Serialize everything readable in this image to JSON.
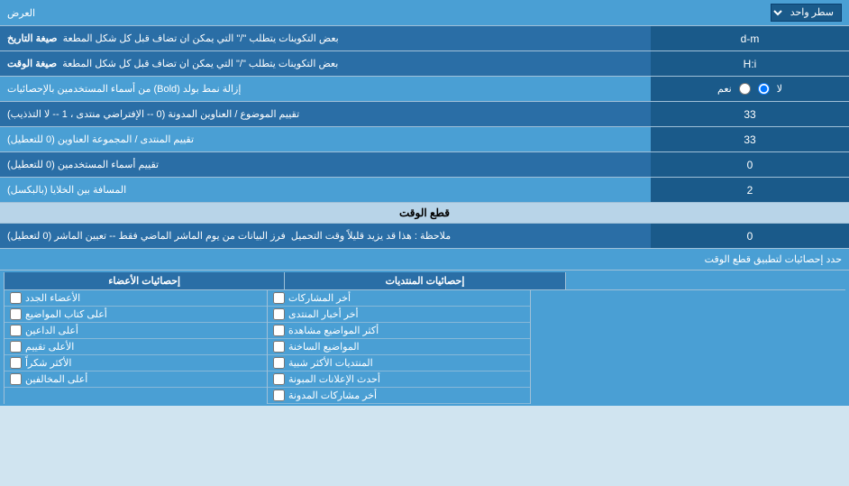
{
  "title": "العرض",
  "top_selector": {
    "label": "العرض",
    "option": "سطر واحد"
  },
  "date_format": {
    "label": "صيغة التاريخ",
    "sublabel": "بعض التكوينات يتطلب \"/\" التي يمكن ان تضاف قبل كل شكل المطعة",
    "value": "d-m"
  },
  "time_format": {
    "label": "صيغة الوقت",
    "sublabel": "بعض التكوينات يتطلب \"/\" التي يمكن ان تضاف قبل كل شكل المطعة",
    "value": "H:i"
  },
  "bold_removal": {
    "label": "إزالة نمط بولد (Bold) من أسماء المستخدمين بالإحصائيات",
    "radio_yes": "نعم",
    "radio_no": "لا",
    "selected": "no"
  },
  "topic_address": {
    "label": "تقييم الموضوع / العناوين المدونة (0 -- الإفتراضي منتدى ، 1 -- لا التذذيب)",
    "value": "33"
  },
  "forum_address": {
    "label": "تقييم المنتدى / المجموعة العناوين (0 للتعطيل)",
    "value": "33"
  },
  "user_names": {
    "label": "تقييم أسماء المستخدمين (0 للتعطيل)",
    "value": "0"
  },
  "cell_spacing": {
    "label": "المسافة بين الخلايا (بالبكسل)",
    "value": "2"
  },
  "cutoff_section": {
    "header": "قطع الوقت",
    "row": {
      "label": "فرز البيانات من يوم الماشر الماضي فقط -- تعيين الماشر (0 لتعطيل)",
      "sublabel": "ملاحظة : هذا قد يزيد قليلاً وقت التحميل",
      "value": "0"
    },
    "apply_label": "حدد إحصائيات لتطبيق قطع الوقت"
  },
  "stats_columns": {
    "col1_header": "إحصائيات الأعضاء",
    "col2_header": "إحصائيات المنتديات",
    "col3_header": "",
    "col1_items": [
      {
        "label": "الأعضاء الجدد",
        "checked": false
      },
      {
        "label": "أعلى كتاب المواضيع",
        "checked": false
      },
      {
        "label": "أعلى الداعين",
        "checked": false
      },
      {
        "label": "الأعلى تقييم",
        "checked": false
      },
      {
        "label": "الأكثر شكراً",
        "checked": false
      },
      {
        "label": "أعلى المخالفين",
        "checked": false
      }
    ],
    "col2_items": [
      {
        "label": "أخر المشاركات",
        "checked": false
      },
      {
        "label": "أخر أخبار المنتدى",
        "checked": false
      },
      {
        "label": "أكثر المواضيع مشاهدة",
        "checked": false
      },
      {
        "label": "المواضيع الساخنة",
        "checked": false
      },
      {
        "label": "المنتديات الأكثر شبية",
        "checked": false
      },
      {
        "label": "أحدث الإعلانات المبونة",
        "checked": false
      },
      {
        "label": "أخر مشاركات المدونة",
        "checked": false
      }
    ]
  }
}
